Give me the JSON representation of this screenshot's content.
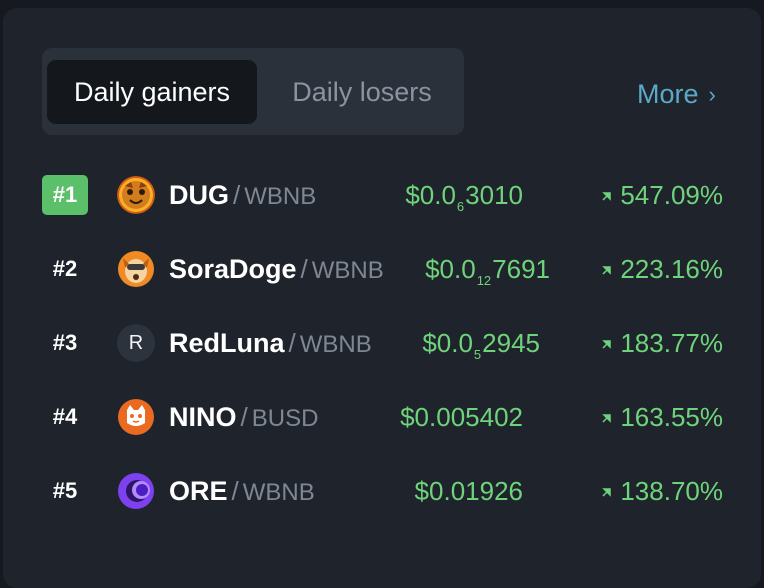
{
  "tabs": {
    "active_label": "Daily gainers",
    "inactive_label": "Daily losers"
  },
  "more": {
    "label": "More",
    "icon": "chevron-right-icon"
  },
  "colors": {
    "positive": "#6fd37b",
    "rank_highlight": "#5cbf6a",
    "link": "#5aa9c9",
    "muted": "#7f8794"
  },
  "rows": [
    {
      "rank": "#1",
      "base": "DUG",
      "sep": "/",
      "quote": "WBNB",
      "price_prefix": "$0.0",
      "price_sub": "6",
      "price_suffix": "3010",
      "change": "547.09%",
      "icon": "dug-token-icon"
    },
    {
      "rank": "#2",
      "base": "SoraDoge",
      "sep": "/",
      "quote": "WBNB",
      "price_prefix": "$0.0",
      "price_sub": "12",
      "price_suffix": "7691",
      "change": "223.16%",
      "icon": "soradoge-token-icon"
    },
    {
      "rank": "#3",
      "base": "RedLuna",
      "sep": "/",
      "quote": "WBNB",
      "price_prefix": "$0.0",
      "price_sub": "5",
      "price_suffix": "2945",
      "change": "183.77%",
      "icon": "redluna-token-icon",
      "logo_letter": "R"
    },
    {
      "rank": "#4",
      "base": "NINO",
      "sep": "/",
      "quote": "BUSD",
      "price_full": "$0.005402",
      "change": "163.55%",
      "icon": "nino-token-icon"
    },
    {
      "rank": "#5",
      "base": "ORE",
      "sep": "/",
      "quote": "WBNB",
      "price_full": "$0.01926",
      "change": "138.70%",
      "icon": "ore-token-icon"
    }
  ]
}
